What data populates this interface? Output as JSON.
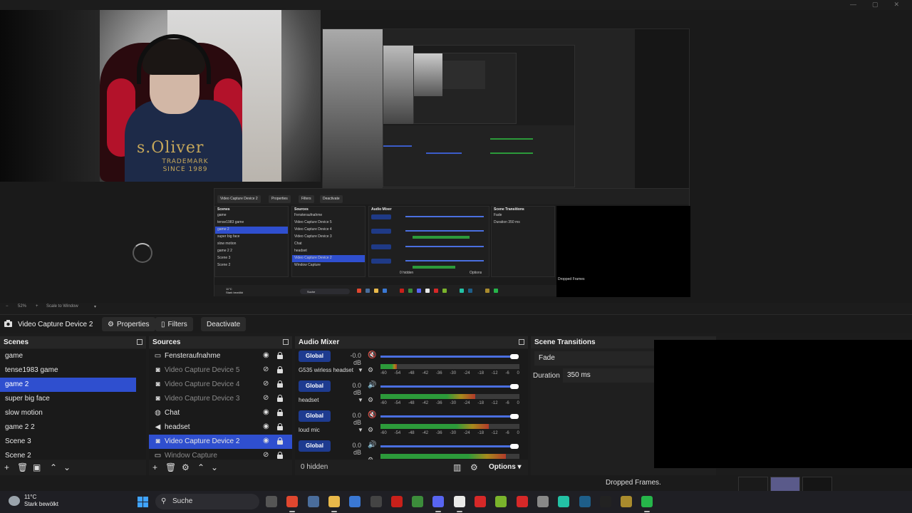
{
  "window": {
    "minimize_icon": "—",
    "maximize_icon": "▢",
    "close_icon": "✕"
  },
  "preview": {
    "shirt_brand": "s.Oliver",
    "shirt_line1": "TRADEMARK",
    "shirt_line2": "SINCE 1989",
    "mini_buttons": [
      "Video Capture Device 2",
      "Properties",
      "Filters",
      "Deactivate"
    ],
    "mini_scenes_title": "Scenes",
    "mini_sources_title": "Sources",
    "mini_mixer_title": "Audio Mixer",
    "mini_transitions_title": "Scene Transitions",
    "mini_scenes": [
      "game",
      "tense1983 game",
      "game 2",
      "super big face",
      "slow motion",
      "game 2 2",
      "Scene 3",
      "Scene 2"
    ],
    "mini_sources": [
      "Fensteraufnahme",
      "Video Capture Device 5",
      "Video Capture Device 4",
      "Video Capture Device 3",
      "Chat",
      "headset",
      "Video Capture Device 2",
      "Window Capture"
    ],
    "mini_fade": "Fade",
    "mini_duration": "Duration",
    "mini_duration_val": "350 ms",
    "mini_hidden": "0 hidden",
    "mini_options": "Options",
    "mini_dropped": "Dropped Frames",
    "mini_search": "Suche",
    "mini_weather": "11°C",
    "mini_weather_desc": "Stark bewölkt"
  },
  "zoombar": {
    "minus": "−",
    "zoom": "52%",
    "plus": "+",
    "mode": "Scale to Window",
    "dropdown": "▾"
  },
  "toolbar": {
    "source_name": "Video Capture Device 2",
    "properties": "Properties",
    "filters": "Filters",
    "deactivate": "Deactivate"
  },
  "scenes": {
    "title": "Scenes",
    "items": [
      "game",
      "tense1983 game",
      "game 2",
      "super big face",
      "slow motion",
      "game 2 2",
      "Scene 3",
      "Scene 2"
    ],
    "selected_index": 2
  },
  "sources": {
    "title": "Sources",
    "items": [
      {
        "label": "Fensteraufnahme",
        "icon": "window-icon",
        "glyph": "▭",
        "visible": true
      },
      {
        "label": "Video Capture Device 5",
        "icon": "camera-icon",
        "glyph": "◙",
        "visible": false
      },
      {
        "label": "Video Capture Device 4",
        "icon": "camera-icon",
        "glyph": "◙",
        "visible": false
      },
      {
        "label": "Video Capture Device 3",
        "icon": "camera-icon",
        "glyph": "◙",
        "visible": false
      },
      {
        "label": "Chat",
        "icon": "globe-icon",
        "glyph": "◍",
        "visible": true
      },
      {
        "label": "headset",
        "icon": "speaker-icon",
        "glyph": "◀",
        "visible": true
      },
      {
        "label": "Video Capture Device 2",
        "icon": "camera-icon",
        "glyph": "◙",
        "visible": true
      },
      {
        "label": "Window Capture",
        "icon": "window-icon",
        "glyph": "▭",
        "visible": false
      }
    ],
    "selected_index": 6
  },
  "mixer": {
    "title": "Audio Mixer",
    "channels": [
      {
        "global": "Global",
        "db": "-0.0 dB",
        "name": "G535 wirless headset",
        "muted": true
      },
      {
        "global": "Global",
        "db": "0.0 dB",
        "name": "headset",
        "muted": false
      },
      {
        "global": "Global",
        "db": "0.0 dB",
        "name": "loud mic",
        "muted": true
      },
      {
        "global": "Global",
        "db": "0.0 dB",
        "name": "",
        "muted": false
      }
    ],
    "ticks": [
      "-60",
      "-54",
      "-48",
      "-42",
      "-36",
      "-30",
      "-24",
      "-18",
      "-12",
      "-6",
      "0"
    ],
    "hidden": "0 hidden",
    "options": "Options",
    "levels": [
      0.12,
      0.68,
      0.78,
      0.9
    ]
  },
  "transitions": {
    "title": "Scene Transitions",
    "type": "Fade",
    "duration_label": "Duration",
    "duration_value": "350 ms"
  },
  "status": {
    "dropped": "Dropped Frames."
  },
  "taskbar": {
    "temp": "11°C",
    "weather": "Stark bewölkt",
    "search": "Suche",
    "icons": [
      {
        "name": "task-view-icon",
        "color": "#555"
      },
      {
        "name": "chrome-icon",
        "color": "#e0472f"
      },
      {
        "name": "calculator-icon",
        "color": "#4a6d9c"
      },
      {
        "name": "file-explorer-icon",
        "color": "#e9b94a"
      },
      {
        "name": "store-icon",
        "color": "#3a78d4"
      },
      {
        "name": "notes-icon",
        "color": "#444"
      },
      {
        "name": "among-us-icon",
        "color": "#c8201a"
      },
      {
        "name": "minecraft-icon",
        "color": "#3c8c3b"
      },
      {
        "name": "discord-icon",
        "color": "#5865f2"
      },
      {
        "name": "obs-icon",
        "color": "#e9e9e9"
      },
      {
        "name": "record-icon",
        "color": "#d62828"
      },
      {
        "name": "xbox-icon",
        "color": "#7ab32c"
      },
      {
        "name": "youtube-icon",
        "color": "#d62828"
      },
      {
        "name": "app-icon",
        "color": "#888"
      },
      {
        "name": "teams-icon",
        "color": "#23c1a5"
      },
      {
        "name": "steam-icon",
        "color": "#1e5e89"
      },
      {
        "name": "capcut-icon",
        "color": "#222"
      },
      {
        "name": "game-icon",
        "color": "#a98b2d"
      },
      {
        "name": "xbox-game-bar-icon",
        "color": "#26b54a"
      }
    ]
  }
}
